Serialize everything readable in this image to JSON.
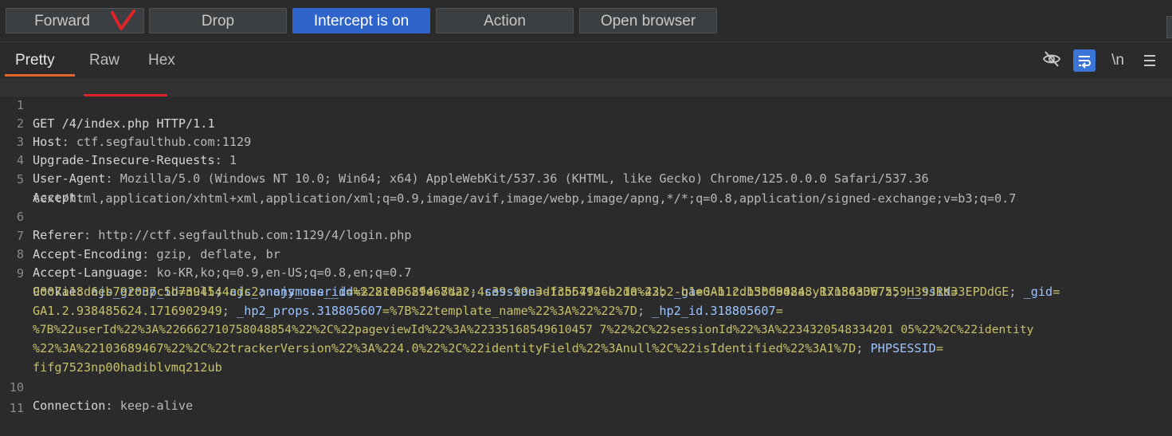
{
  "toolbar": {
    "forward": "Forward",
    "drop": "Drop",
    "intercept": "Intercept is on",
    "action": "Action",
    "open_browser": "Open browser"
  },
  "tabs": {
    "pretty": "Pretty",
    "raw": "Raw",
    "hex": "Hex"
  },
  "tools": {
    "newline": "\\n"
  },
  "colors": {
    "intercept_active": "#2f65ca",
    "tab_underline": "#e2652b",
    "annotation_red": "#e0232b",
    "cookie_name": "#9cc4ff",
    "cookie_value": "#c7c06a"
  },
  "request": {
    "line_numbers": [
      "1",
      "2",
      "3",
      "4",
      "5",
      "6",
      "7",
      "8",
      "9",
      "10",
      "11"
    ],
    "l1": "GET /4/index.php HTTP/1.1",
    "l2_k": "Host",
    "l2_v": ": ctf.segfaulthub.com:1129",
    "l3_k": "Upgrade-Insecure-Requests",
    "l3_v": ": 1",
    "l4_k": "User-Agent",
    "l4_v": ": Mozilla/5.0 (Windows NT 10.0; Win64; x64) AppleWebKit/537.36 (KHTML, like Gecko) Chrome/125.0.0.0 Safari/537.36",
    "l5_k": "Accept",
    "l5_v": ":",
    "l5_c": "text/html,application/xhtml+xml,application/xml;q=0.9,image/avif,image/webp,image/apng,*/*;q=0.8,application/signed-exchange;v=b3;q=0.7",
    "l6_k": "Referer",
    "l6_v": ": http://ctf.segfaulthub.com:1129/4/login.php",
    "l7_k": "Accept-Encoding",
    "l7_v": ": gzip, deflate, br",
    "l8_k": "Accept-Language",
    "l8_v": ": ko-KR,ko;q=0.9,en-US;q=0.8,en;q=0.7",
    "l9_k": "Cookie",
    "l9_sep": ": ",
    "c1k": "ajs_group_id",
    "c1v": "=null",
    "c1s": "; ",
    "c2k": "ajs_anonymous_id",
    "c2v": "=%228ce062fe-8dac-4c39-99e3-13557926a210%22",
    "c2s": "; ",
    "c3k": "_ga",
    "c3v": "=GA1.2.150084848.1715433675",
    "c3s": "; ",
    "c4k": "__ssid",
    "c4v": "=",
    "c4v2": "9007a18d6eb792037c5b7394544cdc2",
    "c4s": "; ",
    "c5k": "ajs_user_id",
    "c5v": "=%22103689467%22",
    "c5s": "; ",
    "c6k": "session",
    "c6v": "=dfcb64f4-b2da-43b2-b1e0-b1cdb3bd902a.yRxn86aDW7z59H39JRK33EPDdGE",
    "c6s": "; ",
    "c7k": "_gid",
    "c7v": "=",
    "c7v2": "GA1.2.938485624.1716902949",
    "c7s": "; ",
    "c8k": "_hp2_props.318805607",
    "c8v": "=%7B%22template_name%22%3A%22%22%7D",
    "c8s": "; ",
    "c9k": "_hp2_id.318805607",
    "c9v": "=",
    "c9v2": "%7B%22userId%22%3A%226662710758048854%22%2C%22pageviewId%22%3A%22335168549610457 7%22%2C%22sessionId%22%3A%2234320548334201 05%22%2C%22identity",
    "c9v3": "%22%3A%22103689467%22%2C%22trackerVersion%22%3A%224.0%22%2C%22identityField%22%3Anull%2C%22isIdentified%22%3A1%7D",
    "c9s": "; ",
    "c10k": "PHPSESSID",
    "c10v": "=",
    "c10v2": "fifg7523np00hadiblvmq212ub",
    "l10_k": "Connection",
    "l10_v": ": keep-alive"
  }
}
